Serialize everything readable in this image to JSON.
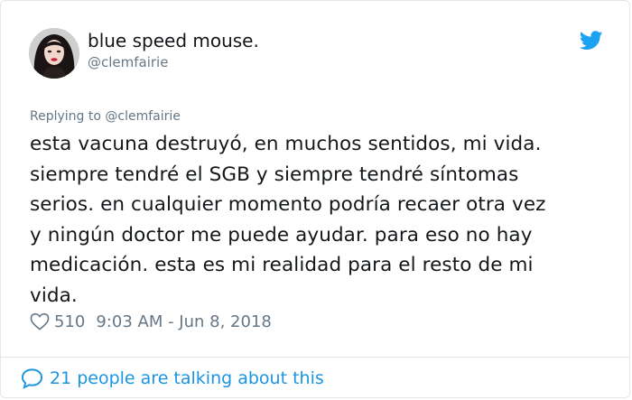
{
  "tweet": {
    "display_name": "blue speed mouse.",
    "handle": "@clemfairie",
    "replying_prefix": "Replying to",
    "replying_to": "@clemfairie",
    "text_lines": [
      "esta vacuna destruyó, en muchos sentidos, mi vida.",
      "siempre tendré el SGB y siempre tendré síntomas",
      "serios. en cualquier momento podría recaer otra vez",
      "y ningún doctor me puede ayudar. para eso no hay",
      "medicación. esta es mi realidad para el resto de mi",
      "vida."
    ],
    "like_count": "510",
    "timestamp": "9:03 AM - Jun 8, 2018",
    "conversation_text": "21 people are talking about this"
  },
  "icons": {
    "logo": "twitter-bird-icon",
    "like": "heart-icon",
    "conversation": "speech-bubble-icon"
  },
  "colors": {
    "brand": "#1da1f2",
    "link": "#1b95e0",
    "secondary_text": "#657786",
    "primary_text": "#14171a",
    "border": "#e1e8ed"
  }
}
